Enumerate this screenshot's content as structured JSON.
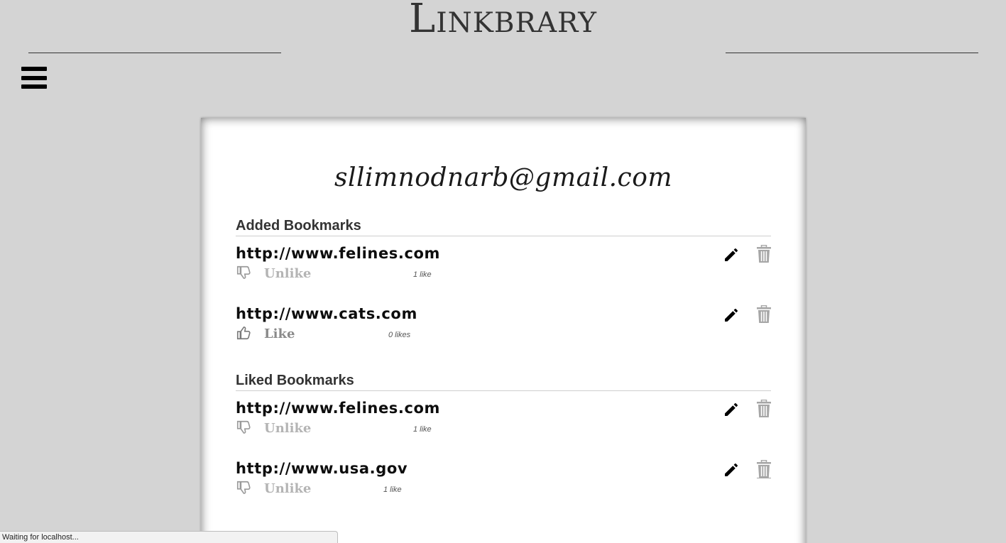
{
  "site": {
    "title": "Linkbrary"
  },
  "user": {
    "email": "sllimnodnarb@gmail.com"
  },
  "sections": {
    "added_heading": "Added Bookmarks",
    "liked_heading": "Liked Bookmarks"
  },
  "added_bookmarks": [
    {
      "url": "http://www.felines.com",
      "like_action": "Unlike",
      "like_count": "1 like",
      "icon": "thumbs-down-icon"
    },
    {
      "url": "http://www.cats.com",
      "like_action": "Like",
      "like_count": "0 likes",
      "icon": "thumbs-up-icon"
    }
  ],
  "liked_bookmarks": [
    {
      "url": "http://www.felines.com",
      "like_action": "Unlike",
      "like_count": "1 like",
      "icon": "thumbs-down-icon"
    },
    {
      "url": "http://www.usa.gov",
      "like_action": "Unlike",
      "like_count": "1 like",
      "icon": "thumbs-down-icon"
    }
  ],
  "status_bar": {
    "text": "Waiting for localhost..."
  },
  "colors": {
    "background": "#d4d4d4",
    "card": "#ffffff",
    "heading": "#333333",
    "muted_action": "#b4b4b4",
    "delete_icon": "#a6a6a6"
  }
}
